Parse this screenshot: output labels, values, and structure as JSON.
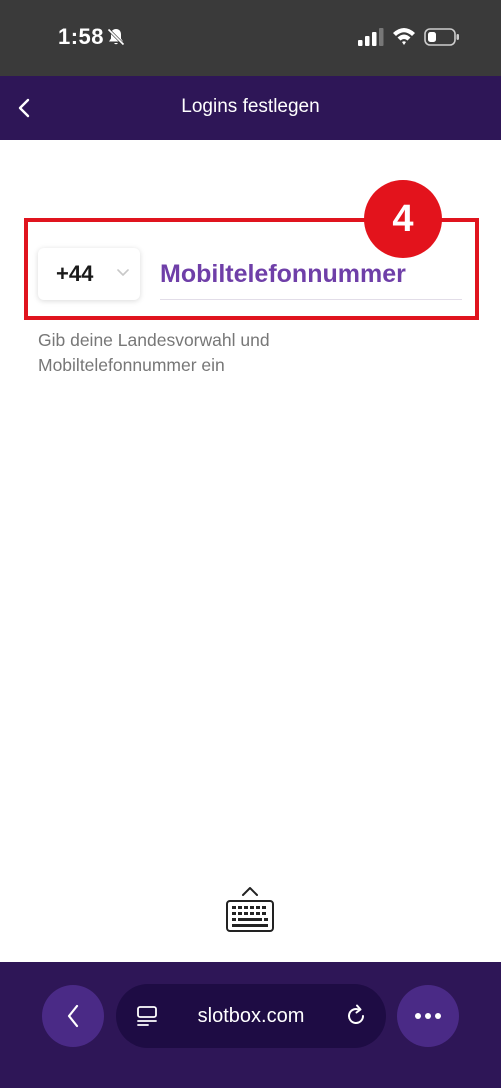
{
  "status_bar": {
    "time": "1:58",
    "icons": [
      "bell-off-icon",
      "signal-icon",
      "wifi-icon",
      "battery-icon"
    ]
  },
  "header": {
    "title": "Logins festlegen",
    "back_icon": "chevron-left-icon"
  },
  "annotation": {
    "step_number": "4",
    "highlight_color": "#e0141e",
    "badge_color": "#e3131c"
  },
  "phone_form": {
    "country_code": "+44",
    "phone_placeholder": "Mobiltelefonnummer",
    "phone_value": "",
    "helper_text": "Gib deine Landesvorwahl und Mobiltelefonnummer ein"
  },
  "keyboard_toggle": {
    "icon": "keyboard-icon"
  },
  "browser_bar": {
    "url": "slotbox.com",
    "icons": [
      "chevron-left-icon",
      "tabs-icon",
      "reload-icon",
      "more-icon"
    ]
  },
  "colors": {
    "header_bg": "#2e1657",
    "accent_purple": "#6f3fa8",
    "status_bar_bg": "#3a3a3a"
  }
}
